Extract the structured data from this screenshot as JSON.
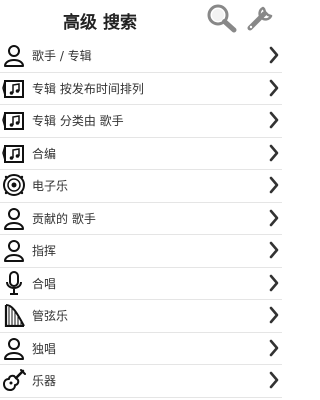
{
  "header": {
    "title": "高级 搜索",
    "search_icon": "search-icon",
    "settings_icon": "wrench-icon"
  },
  "items": [
    {
      "label": "歌手 / 专辑",
      "icon": "person-icon"
    },
    {
      "label": "专辑 按发布时间排列",
      "icon": "music-folder-icon"
    },
    {
      "label": "专辑 分类由 歌手",
      "icon": "music-folder-icon"
    },
    {
      "label": "合编",
      "icon": "music-folder-icon"
    },
    {
      "label": "电子乐",
      "icon": "speaker-icon"
    },
    {
      "label": "贡献的 歌手",
      "icon": "person-icon"
    },
    {
      "label": "指挥",
      "icon": "person-icon"
    },
    {
      "label": "合唱",
      "icon": "microphone-icon"
    },
    {
      "label": "管弦乐",
      "icon": "harp-icon"
    },
    {
      "label": "独唱",
      "icon": "person-icon"
    },
    {
      "label": "乐器",
      "icon": "guitar-icon"
    }
  ]
}
